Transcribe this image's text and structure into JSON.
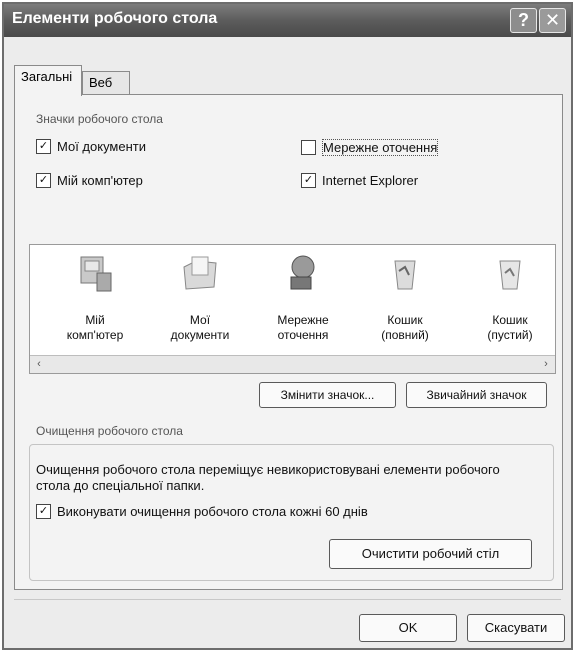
{
  "window": {
    "title": "Елементи робочого стола",
    "help_glyph": "?",
    "close_glyph": "✕"
  },
  "tabs": [
    {
      "label": "Загальні",
      "active": true
    },
    {
      "label": "Веб",
      "active": false
    }
  ],
  "icons_group": {
    "label": "Значки робочого стола",
    "checkboxes": [
      {
        "label": "Мої документи",
        "checked": true
      },
      {
        "label": "Мережне оточення",
        "checked": false
      },
      {
        "label": "Мій комп'ютер",
        "checked": true
      },
      {
        "label": "Internet Explorer",
        "checked": true
      }
    ]
  },
  "icon_list": [
    {
      "label": "Мій\nкомп'ютер",
      "icon": "computer-icon"
    },
    {
      "label": "Мої\nдокументи",
      "icon": "documents-folder-icon"
    },
    {
      "label": "Мережне\nоточення",
      "icon": "network-icon"
    },
    {
      "label": "Кошик\n(повний)",
      "icon": "recycle-bin-full-icon"
    },
    {
      "label": "Кошик\n(пустий)",
      "icon": "recycle-bin-empty-icon"
    }
  ],
  "buttons": {
    "change_icon": "Змінити значок...",
    "default_icon": "Звичайний значок",
    "clean_desktop": "Очистити робочий стіл",
    "ok": "OK",
    "cancel": "Скасувати"
  },
  "cleanup": {
    "label": "Очищення робочого стола",
    "description": "Очищення робочого стола переміщує невикористовувані елементи робочого стола до спеціальної папки.",
    "checkbox_label": "Виконувати очищення робочого стола кожні 60 днів",
    "checkbox_checked": true
  },
  "check_glyph": "✓",
  "scroll": {
    "left_glyph": "‹",
    "right_glyph": "›"
  }
}
